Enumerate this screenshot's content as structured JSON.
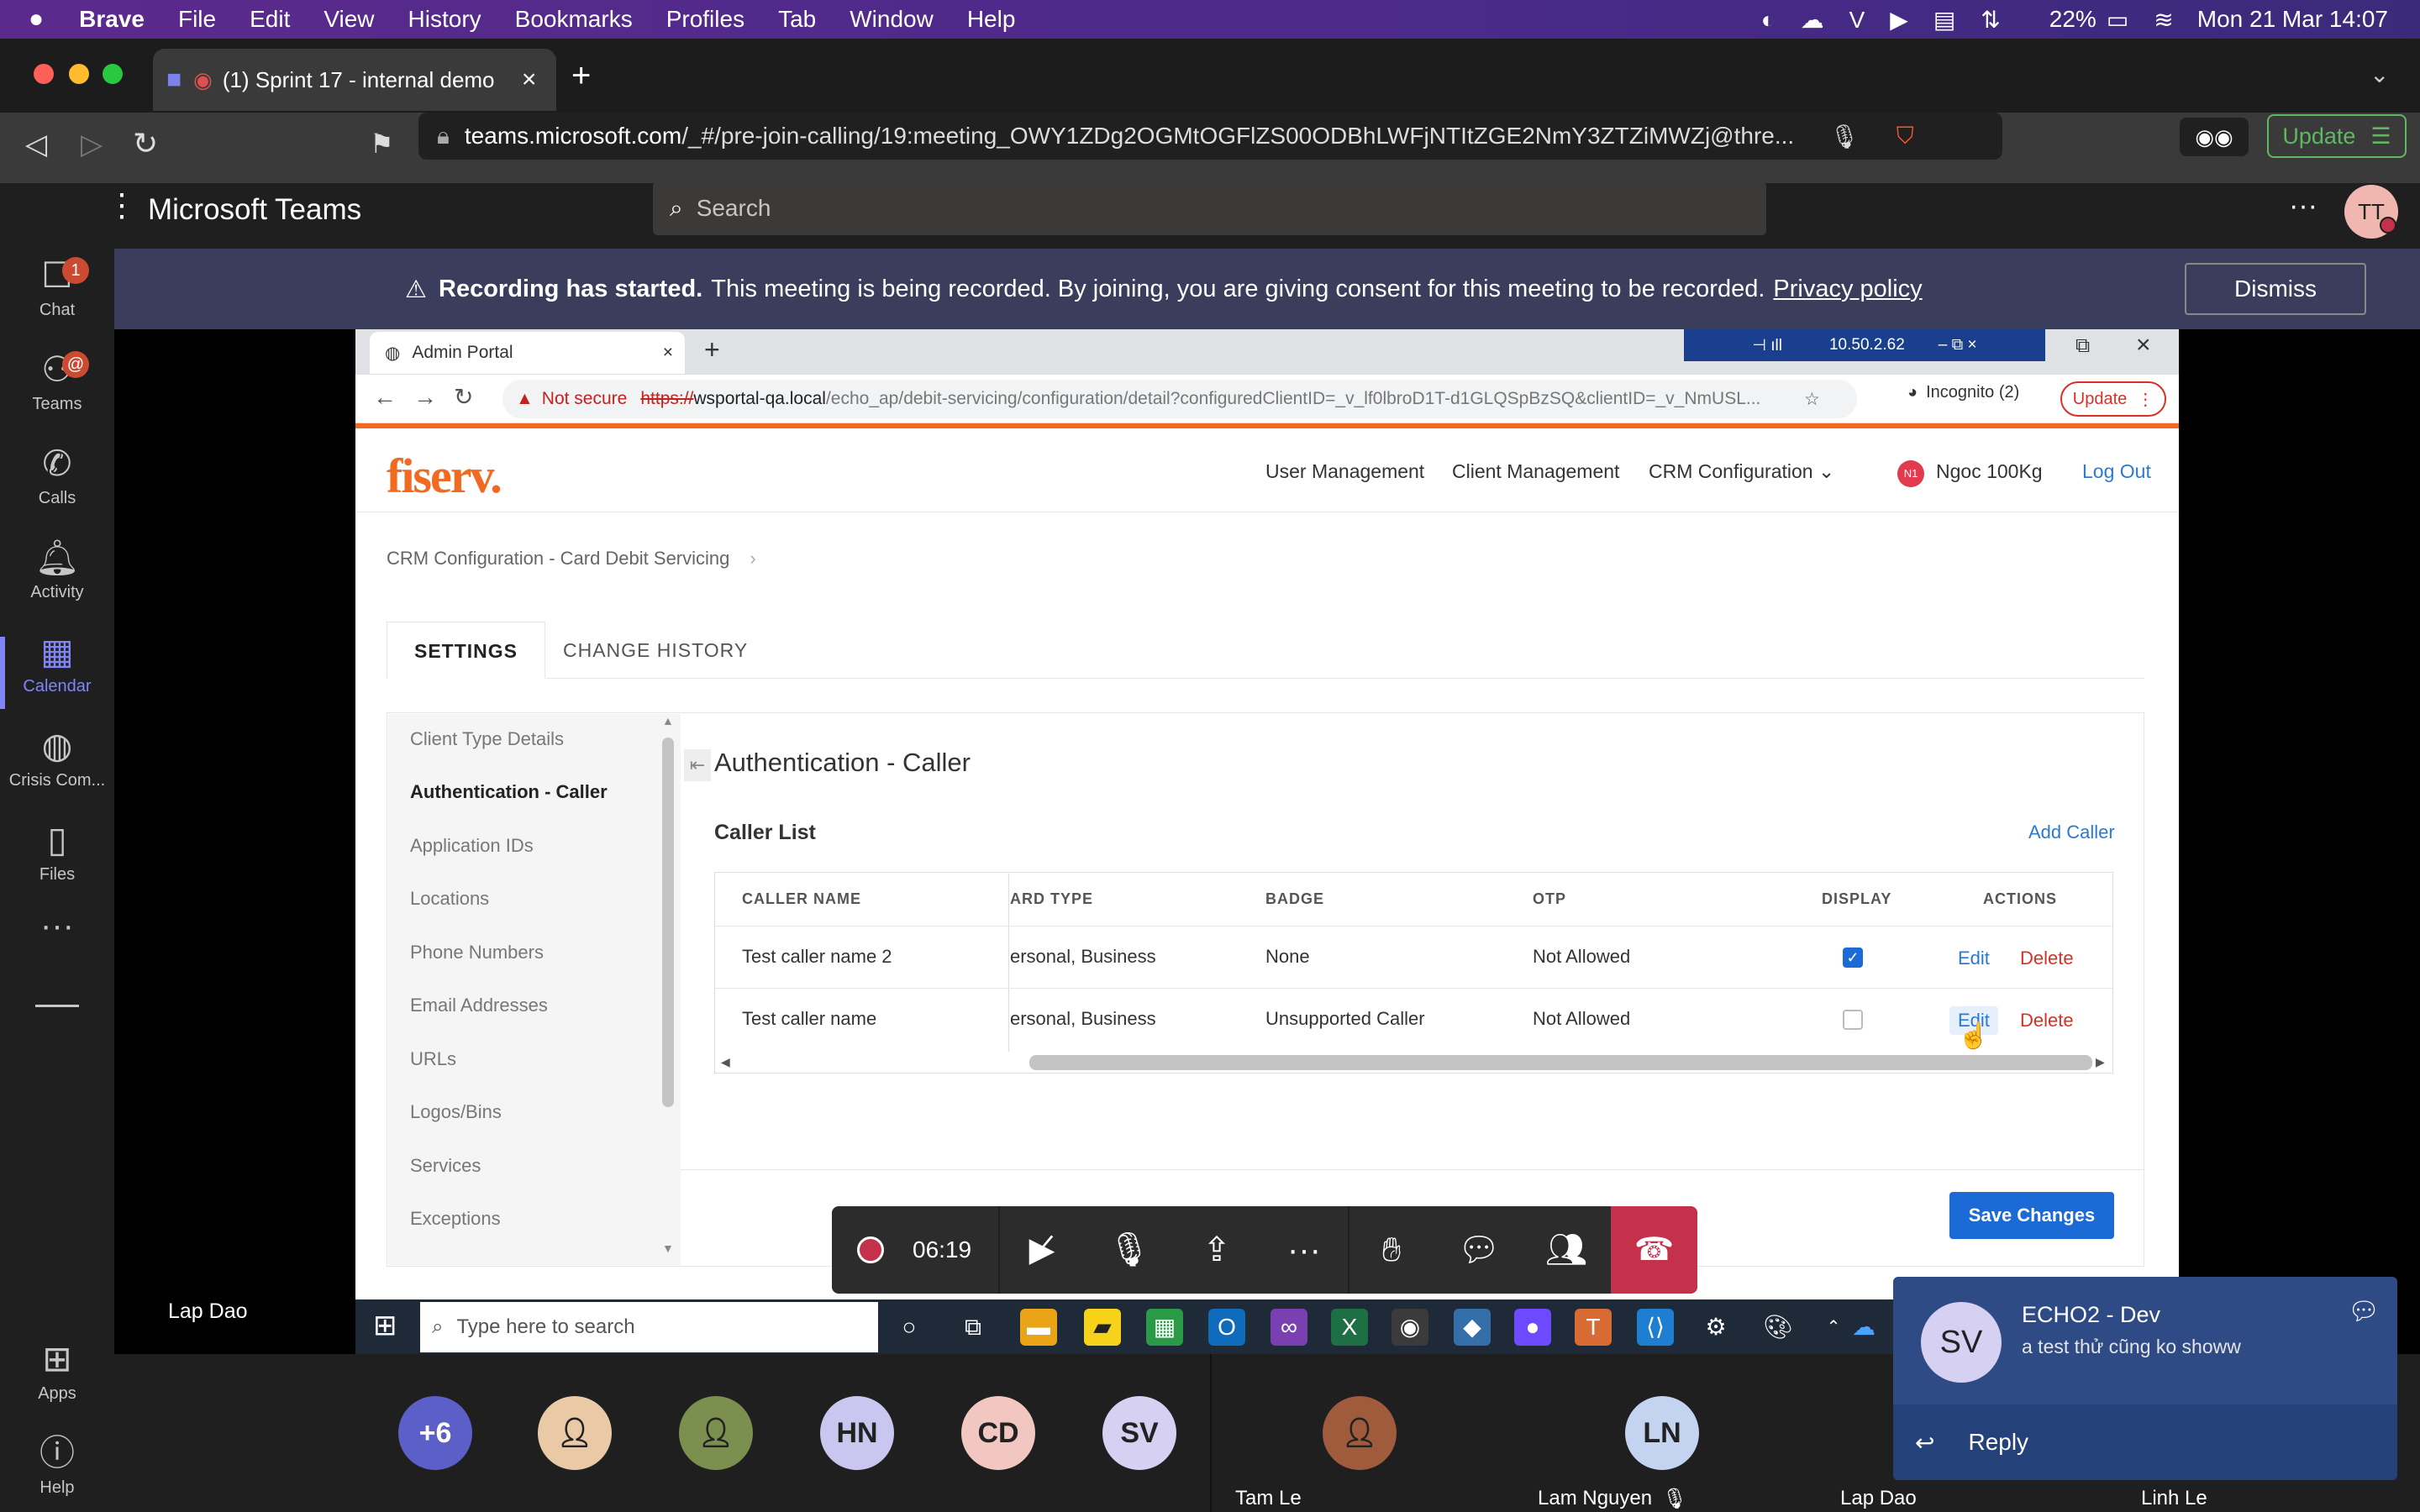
{
  "menubar": {
    "app": "Brave",
    "items": [
      "File",
      "Edit",
      "View",
      "History",
      "Bookmarks",
      "Profiles",
      "Tab",
      "Window",
      "Help"
    ],
    "battery": "22%",
    "datetime": "Mon 21 Mar  14:07"
  },
  "browser": {
    "tab_title": "(1) Sprint 17 - internal demo",
    "url_host": "teams.microsoft.com",
    "url_path": "/_#/pre-join-calling/19:meeting_OWY1ZDg2OGMtOGFlZS00ODBhLWFjNTItZGE2NmY3ZTZiMWZj@thre...",
    "update_label": "Update"
  },
  "teams": {
    "title": "Microsoft Teams",
    "search_placeholder": "Search",
    "avatar_initials": "TT",
    "rail": [
      {
        "label": "Chat",
        "badge": "1"
      },
      {
        "label": "Teams",
        "badge": "@"
      },
      {
        "label": "Calls"
      },
      {
        "label": "Activity"
      },
      {
        "label": "Calendar"
      },
      {
        "label": "Crisis Com..."
      },
      {
        "label": "Files"
      },
      {
        "label": "Apps"
      },
      {
        "label": "Help"
      }
    ]
  },
  "banner": {
    "bold": "Recording has started.",
    "text": "This meeting is being recorded. By joining, you are giving consent for this meeting to be recorded.",
    "link": "Privacy policy",
    "dismiss": "Dismiss"
  },
  "shared": {
    "tab_title": "Admin Portal",
    "rdp_ip": "10.50.2.62",
    "not_secure": "Not secure",
    "url_scheme": "https://",
    "url_host": "wsportal-qa.local",
    "url_path": "/echo_ap/debit-servicing/configuration/detail?configuredClientID=_v_lf0lbroD1T-d1GLQSpBzSQ&clientID=_v_NmUSL...",
    "incognito": "Incognito (2)",
    "update": "Update",
    "logo": "fiserv.",
    "nav": [
      "User Management",
      "Client Management",
      "CRM Configuration"
    ],
    "user_badge": "N1",
    "user": "Ngoc 100Kg",
    "logout": "Log Out",
    "breadcrumb": "CRM Configuration - Card Debit Servicing",
    "tabs": [
      "SETTINGS",
      "CHANGE HISTORY"
    ],
    "side_menu": [
      "Client Type Details",
      "Authentication - Caller",
      "Application IDs",
      "Locations",
      "Phone Numbers",
      "Email Addresses",
      "URLs",
      "Logos/Bins",
      "Services",
      "Exceptions"
    ],
    "section_title": "Authentication - Caller",
    "list_title": "Caller List",
    "add_caller": "Add Caller",
    "columns": [
      "CALLER NAME",
      "ARD TYPE",
      "BADGE",
      "OTP",
      "DISPLAY",
      "ACTIONS"
    ],
    "rows": [
      {
        "name": "Test caller name 2",
        "card_type": "ersonal, Business",
        "badge": "None",
        "otp": "Not Allowed",
        "display": true,
        "edit": "Edit",
        "delete": "Delete"
      },
      {
        "name": "Test caller name",
        "card_type": "ersonal, Business",
        "badge": "Unsupported Caller",
        "otp": "Not Allowed",
        "display": false,
        "edit": "Edit",
        "delete": "Delete"
      }
    ],
    "save": "Save Changes",
    "presenter": "Lap Dao",
    "win_search": "Type here to search"
  },
  "controls": {
    "timer": "06:19"
  },
  "participants": {
    "overflow": "+6",
    "avatars": [
      "HN",
      "CD",
      "SV"
    ],
    "names": [
      "Tam Le",
      "Lam Nguyen",
      "Lap Dao",
      "Linh Le"
    ],
    "tile_initials": "LN"
  },
  "toast": {
    "initials": "SV",
    "title": "ECHO2 - Dev",
    "message": "a test thử cũng ko showw",
    "reply": "Reply"
  },
  "colors": {
    "accent": "#1b6ad6",
    "brand": "#f26a21",
    "teams_purple": "#5b5fc7",
    "leave": "#c4314b"
  }
}
